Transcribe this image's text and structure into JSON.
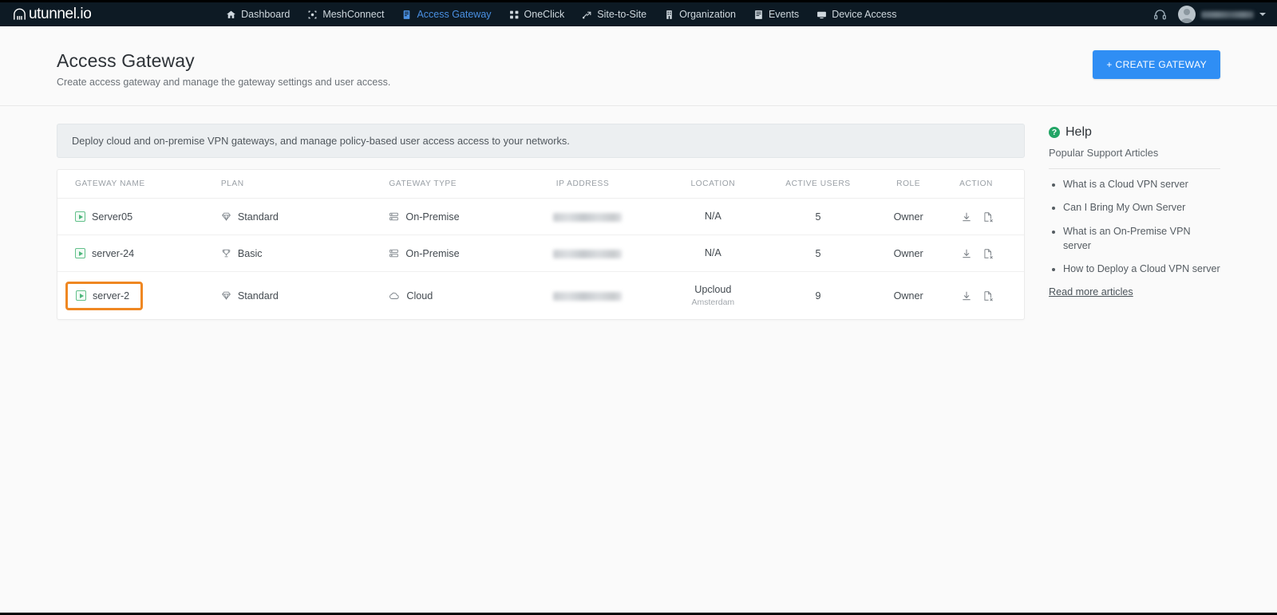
{
  "brand": {
    "name": "utunnel.io",
    "logo_icon": "tunnel-logo-icon"
  },
  "topnav": {
    "items": [
      {
        "label": "Dashboard",
        "icon": "home-icon",
        "active": false
      },
      {
        "label": "MeshConnect",
        "icon": "mesh-icon",
        "active": false
      },
      {
        "label": "Access Gateway",
        "icon": "gateway-icon",
        "active": true
      },
      {
        "label": "OneClick",
        "icon": "oneclick-icon",
        "active": false
      },
      {
        "label": "Site-to-Site",
        "icon": "site-to-site-icon",
        "active": false
      },
      {
        "label": "Organization",
        "icon": "organization-icon",
        "active": false
      },
      {
        "label": "Events",
        "icon": "events-icon",
        "active": false
      },
      {
        "label": "Device Access",
        "icon": "device-access-icon",
        "active": false
      }
    ],
    "support_icon": "headset-icon",
    "user_menu": {
      "avatar": "user-avatar",
      "name": "",
      "caret": "chevron-down-icon"
    }
  },
  "header": {
    "title": "Access Gateway",
    "subtitle": "Create access gateway and manage the gateway settings and user access.",
    "create_button": "+ CREATE GATEWAY"
  },
  "info_banner": {
    "text": "Deploy cloud and on-premise VPN gateways, and manage policy-based user access access to your networks."
  },
  "table": {
    "columns": [
      "GATEWAY NAME",
      "PLAN",
      "GATEWAY TYPE",
      "IP ADDRESS",
      "LOCATION",
      "ACTIVE USERS",
      "ROLE",
      "ACTION"
    ],
    "rows": [
      {
        "name": "Server05",
        "status_icon": "gateway-running-icon",
        "plan": "Standard",
        "plan_icon": "diamond-icon",
        "type": "On-Premise",
        "type_icon": "server-stack-icon",
        "ip": "",
        "ip_redacted": true,
        "location": "N/A",
        "location_sub": "",
        "active_users": "5",
        "role": "Owner",
        "actions": [
          "download-config-icon",
          "revoke-config-icon"
        ],
        "highlighted": false
      },
      {
        "name": "server-24",
        "status_icon": "gateway-running-icon",
        "plan": "Basic",
        "plan_icon": "trophy-icon",
        "type": "On-Premise",
        "type_icon": "server-stack-icon",
        "ip": "",
        "ip_redacted": true,
        "location": "N/A",
        "location_sub": "",
        "active_users": "5",
        "role": "Owner",
        "actions": [
          "download-config-icon",
          "revoke-config-icon"
        ],
        "highlighted": false
      },
      {
        "name": "server-2",
        "status_icon": "gateway-running-icon",
        "plan": "Standard",
        "plan_icon": "diamond-icon",
        "type": "Cloud",
        "type_icon": "cloud-icon",
        "ip": "",
        "ip_redacted": true,
        "location": "Upcloud",
        "location_sub": "Amsterdam",
        "active_users": "9",
        "role": "Owner",
        "actions": [
          "download-config-icon",
          "revoke-config-icon"
        ],
        "highlighted": true
      }
    ]
  },
  "help": {
    "title": "Help",
    "title_icon": "help-circle-icon",
    "subtitle": "Popular Support Articles",
    "articles": [
      "What is a Cloud VPN server",
      "Can I Bring My Own Server",
      "What is an On-Premise VPN server",
      "How to Deploy a Cloud VPN server"
    ],
    "read_more": "Read more articles"
  },
  "colors": {
    "nav_bg": "#0d1a24",
    "accent_blue": "#2f8ef4",
    "active_tab": "#4a90e2",
    "highlight_orange": "#ef8722",
    "status_green": "#4eb67c",
    "help_green": "#23a566",
    "page_bg": "#fafafa"
  }
}
